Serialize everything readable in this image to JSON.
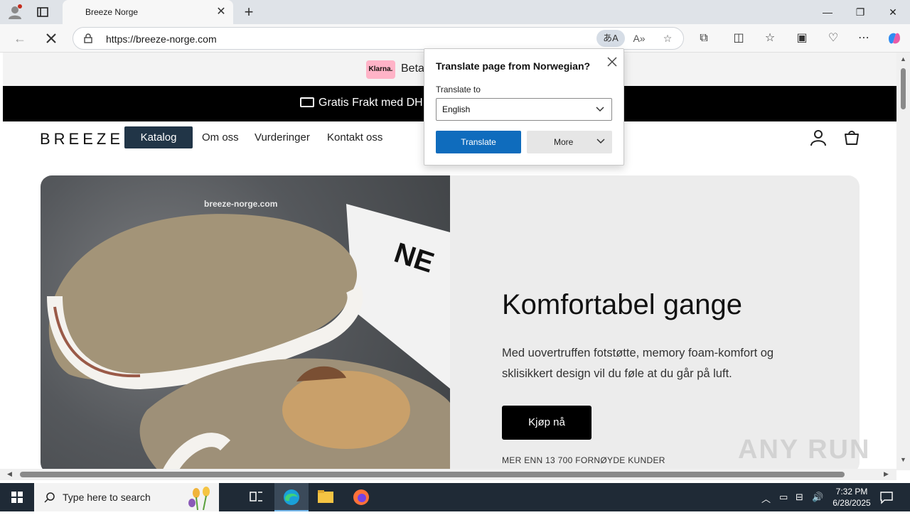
{
  "browser": {
    "tab_title": "Breeze Norge",
    "url": "https://breeze-norge.com",
    "new_tab_symbol": "+",
    "minimize": "—",
    "restore": "❐",
    "close": "✕"
  },
  "site": {
    "promo_text": "Beta",
    "klarna_logo": "Klarna.",
    "shipping_text": "Gratis Frakt med DH",
    "logo": "BREEZE",
    "nav": [
      "Katalog",
      "Om oss",
      "Vurderinger",
      "Kontakt oss"
    ],
    "hero": {
      "watermark": "breeze-norge.com",
      "title": "Komfortabel gange",
      "body": "Med uovertruffen fotstøtte, memory foam-komfort og sklisikkert design vil du føle at du går på luft.",
      "cta": "Kjøp nå",
      "note": "MER ENN 13 700 FORNØYDE KUNDER"
    }
  },
  "translate_popup": {
    "title": "Translate page from Norwegian?",
    "label": "Translate to",
    "selected_language": "English",
    "translate_button": "Translate",
    "more_button": "More"
  },
  "watermark_overlay": "ANY RUN",
  "taskbar": {
    "search_placeholder": "Type here to search",
    "time": "7:32 PM",
    "date": "6/28/2025"
  }
}
